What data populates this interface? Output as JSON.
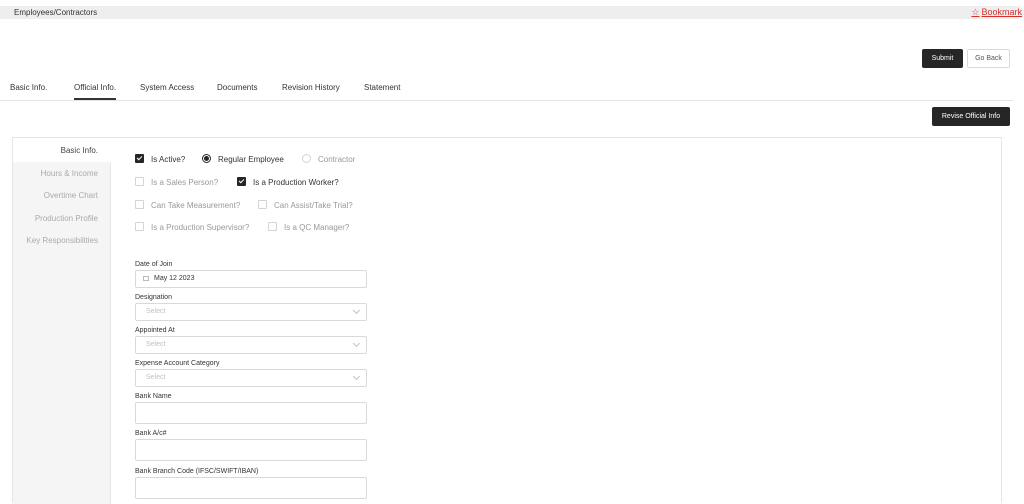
{
  "breadcrumb": {
    "text": "Employees/Contractors"
  },
  "bookmark": {
    "label": "Bookmark",
    "icon": "star-icon"
  },
  "actions": {
    "submit": "Submit",
    "go_back": "Go Back",
    "revise": "Revise Official Info"
  },
  "tabs": [
    {
      "label": "Basic Info.",
      "active": false
    },
    {
      "label": "Official Info.",
      "active": true
    },
    {
      "label": "System Access",
      "active": false
    },
    {
      "label": "Documents",
      "active": false
    },
    {
      "label": "Revision History",
      "active": false
    },
    {
      "label": "Statement",
      "active": false
    }
  ],
  "sidenav": [
    {
      "label": "Basic Info.",
      "active": true
    },
    {
      "label": "Hours & Income",
      "active": false
    },
    {
      "label": "Overtime Chart",
      "active": false
    },
    {
      "label": "Production Profile",
      "active": false
    },
    {
      "label": "Key Responsibilities",
      "active": false
    }
  ],
  "options": {
    "is_active": {
      "label": "Is Active?",
      "checked": true
    },
    "regular_employee": {
      "label": "Regular Employee",
      "selected": true
    },
    "contractor": {
      "label": "Contractor",
      "selected": false
    },
    "sales_person": {
      "label": "Is a Sales Person?",
      "checked": false
    },
    "production_worker": {
      "label": "Is a Production Worker?",
      "checked": true
    },
    "take_measurement": {
      "label": "Can Take Measurement?",
      "checked": false
    },
    "assist_trial": {
      "label": "Can Assist/Take Trial?",
      "checked": false
    },
    "production_supervisor": {
      "label": "Is a Production Supervisor?",
      "checked": false
    },
    "qc_manager": {
      "label": "Is a QC Manager?",
      "checked": false
    }
  },
  "form": {
    "date_of_join": {
      "label": "Date of Join",
      "value": "May 12 2023"
    },
    "designation": {
      "label": "Designation",
      "placeholder": "Select"
    },
    "appointed_at": {
      "label": "Appointed At",
      "placeholder": "Select"
    },
    "expense_category": {
      "label": "Expense Account Category",
      "placeholder": "Select"
    },
    "bank_name": {
      "label": "Bank Name",
      "value": ""
    },
    "bank_account": {
      "label": "Bank A/c#",
      "value": ""
    },
    "bank_branch_code": {
      "label": "Bank Branch Code (IFSC/SWIFT/IBAN)",
      "value": ""
    }
  },
  "colors": {
    "accent": "#262626",
    "bookmark": "#d9302c",
    "sidebar_bg": "#f5f5f5"
  }
}
